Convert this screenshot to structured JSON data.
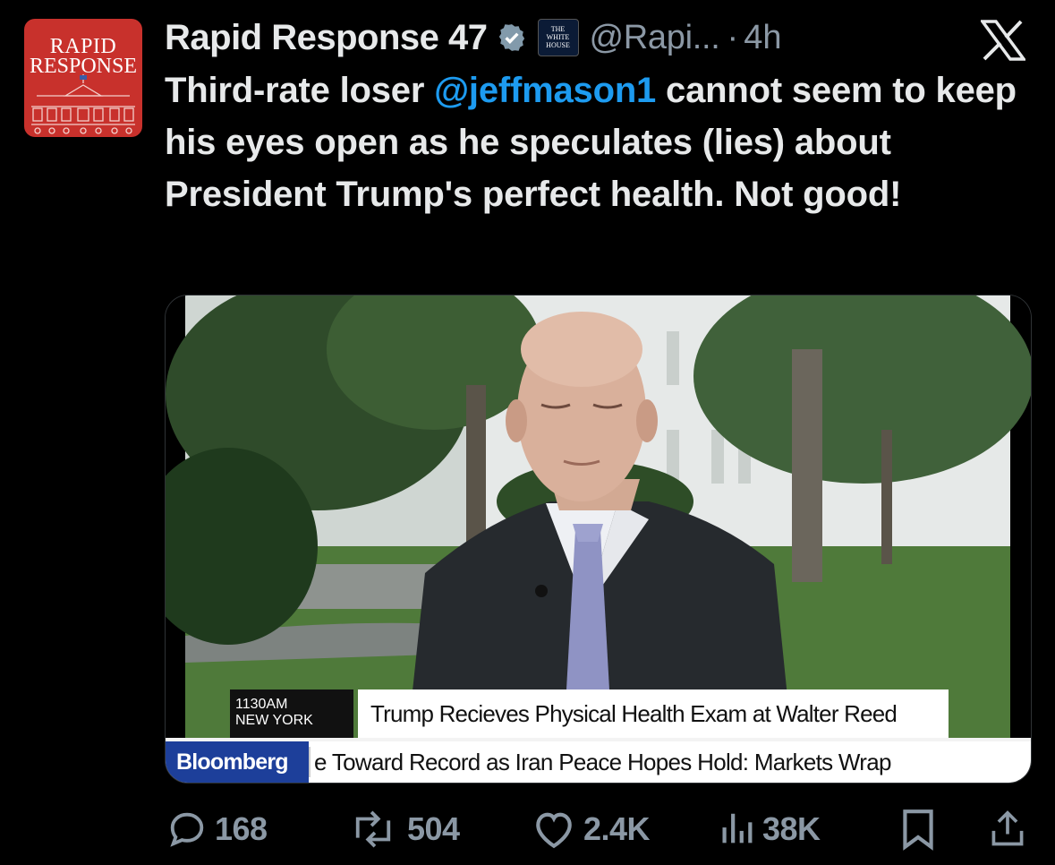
{
  "avatar": {
    "line1": "RAPID",
    "line2": "RESPONSE"
  },
  "header": {
    "display_name": "Rapid Response 47",
    "affiliation_line1": "THE",
    "affiliation_line2": "WHITE",
    "affiliation_line3": "HOUSE",
    "handle": "@Rapi...",
    "separator": "·",
    "time": "4h"
  },
  "tweet": {
    "text_before": "Third-rate loser ",
    "mention": "@jeffmason1",
    "text_after": " cannot seem to keep his eyes open as he speculates (lies) about President Trump's perfect health. Not good!"
  },
  "media": {
    "time_line1": "1130AM",
    "time_line2": "NEW YORK",
    "headline": "Trump Recieves Physical Health Exam at Walter Reed",
    "ticker_brand": "Bloomberg",
    "ticker_text": "e Toward Record as Iran Peace Hopes Hold: Markets Wrap"
  },
  "actions": {
    "replies": "168",
    "reposts": "504",
    "likes": "2.4K",
    "views": "38K"
  },
  "colors": {
    "accent": "#1d9bf0",
    "muted": "#8b98a5",
    "avatar_bg": "#c8312c",
    "bloomberg": "#1d3f9a"
  },
  "icons": [
    "verified-icon",
    "x-logo-icon",
    "reply-icon",
    "repost-icon",
    "like-icon",
    "views-icon",
    "bookmark-icon",
    "share-icon"
  ]
}
